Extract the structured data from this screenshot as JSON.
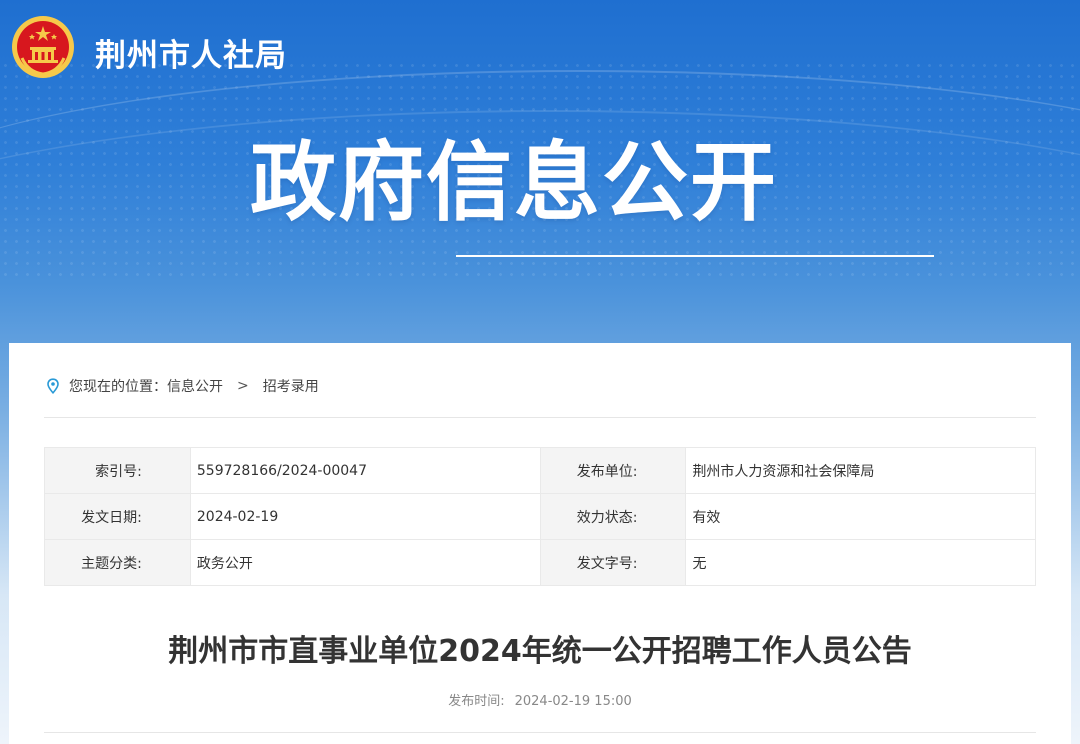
{
  "header": {
    "site_name": "荆州市人社局",
    "hero_title": "政府信息公开"
  },
  "breadcrumb": {
    "prefix": "您现在的位置：",
    "items": [
      "信息公开",
      "招考录用"
    ],
    "separator": ">"
  },
  "meta_table": {
    "rows": [
      [
        {
          "label": "索引号:",
          "value": "559728166/2024-00047"
        },
        {
          "label": "发布单位:",
          "value": "荆州市人力资源和社会保障局"
        }
      ],
      [
        {
          "label": "发文日期:",
          "value": "2024-02-19"
        },
        {
          "label": "效力状态:",
          "value": "有效"
        }
      ],
      [
        {
          "label": "主题分类:",
          "value": "政务公开"
        },
        {
          "label": "发文字号:",
          "value": "无"
        }
      ]
    ]
  },
  "article": {
    "title": "荆州市市直事业单位2024年统一公开招聘工作人员公告",
    "publish_label": "发布时间:",
    "publish_time": "2024-02-19 15:00"
  },
  "colors": {
    "banner_top": "#1f6fd0",
    "banner_bottom": "#eef4fb",
    "emblem_red": "#d7171e",
    "emblem_gold": "#f6c94a",
    "pin_icon": "#2a9ad6"
  },
  "icons": {
    "emblem": "national-emblem-icon",
    "location": "location-pin-icon"
  }
}
